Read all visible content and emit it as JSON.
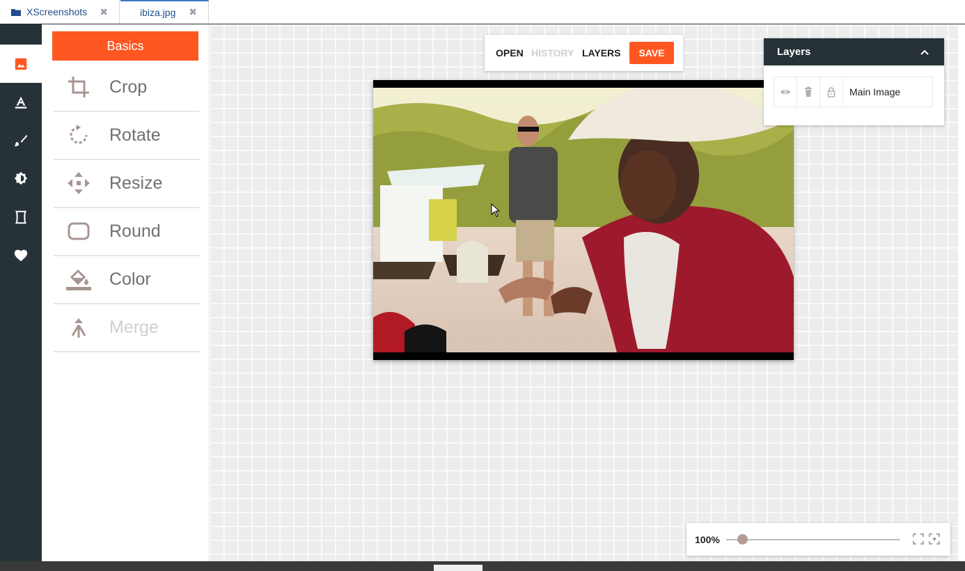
{
  "tabs": [
    {
      "label": "XScreenshots",
      "icon": "folder-icon",
      "close": "✖"
    },
    {
      "label": "ibiza.jpg",
      "close": "✖"
    }
  ],
  "sidebar": {
    "active": "image",
    "items": [
      "image-icon",
      "text-icon",
      "brush-icon",
      "filter-icon",
      "frame-icon",
      "sticker-heart-icon"
    ]
  },
  "panel": {
    "title": "Basics",
    "tools": [
      {
        "label": "Crop",
        "icon": "crop-icon",
        "enabled": true
      },
      {
        "label": "Rotate",
        "icon": "rotate-icon",
        "enabled": true
      },
      {
        "label": "Resize",
        "icon": "resize-icon",
        "enabled": true
      },
      {
        "label": "Round",
        "icon": "round-corners-icon",
        "enabled": true
      },
      {
        "label": "Color",
        "icon": "fill-color-icon",
        "enabled": true
      },
      {
        "label": "Merge",
        "icon": "merge-icon",
        "enabled": false
      }
    ]
  },
  "toolbar": {
    "open": "OPEN",
    "history": "HISTORY",
    "layers": "LAYERS",
    "save": "SAVE"
  },
  "layers_panel": {
    "title": "Layers",
    "layers": [
      {
        "name": "Main Image"
      }
    ]
  },
  "zoom": {
    "value": "100%",
    "level": 0.07
  },
  "colors": {
    "accent": "#ff5722",
    "rail": "#263238",
    "tab_text": "#1f4e8c"
  }
}
